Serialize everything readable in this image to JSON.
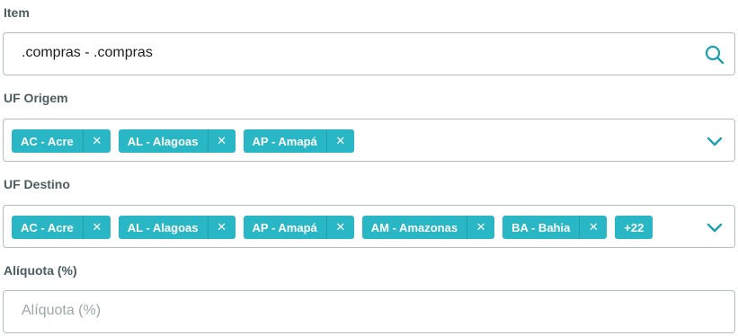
{
  "item": {
    "label": "Item",
    "value": ".compras - .compras",
    "search_icon": "search-icon"
  },
  "uf_origem": {
    "label": "UF Origem",
    "tags": [
      "AC - Acre",
      "AL - Alagoas",
      "AP - Amapá"
    ],
    "remove_glyph": "✕",
    "dropdown_icon": "chevron-down-icon"
  },
  "uf_destino": {
    "label": "UF Destino",
    "tags": [
      "AC - Acre",
      "AL - Alagoas",
      "AP - Amapá",
      "AM - Amazonas",
      "BA - Bahia"
    ],
    "more": "+22",
    "remove_glyph": "✕",
    "dropdown_icon": "chevron-down-icon"
  },
  "aliquota": {
    "label": "Alíquota (%)",
    "placeholder": "Alíquota (%)",
    "value": ""
  },
  "colors": {
    "accent": "#29b6c5",
    "icon": "#1a9fb0",
    "label": "#4a5c60",
    "border": "#b6bdbf"
  }
}
